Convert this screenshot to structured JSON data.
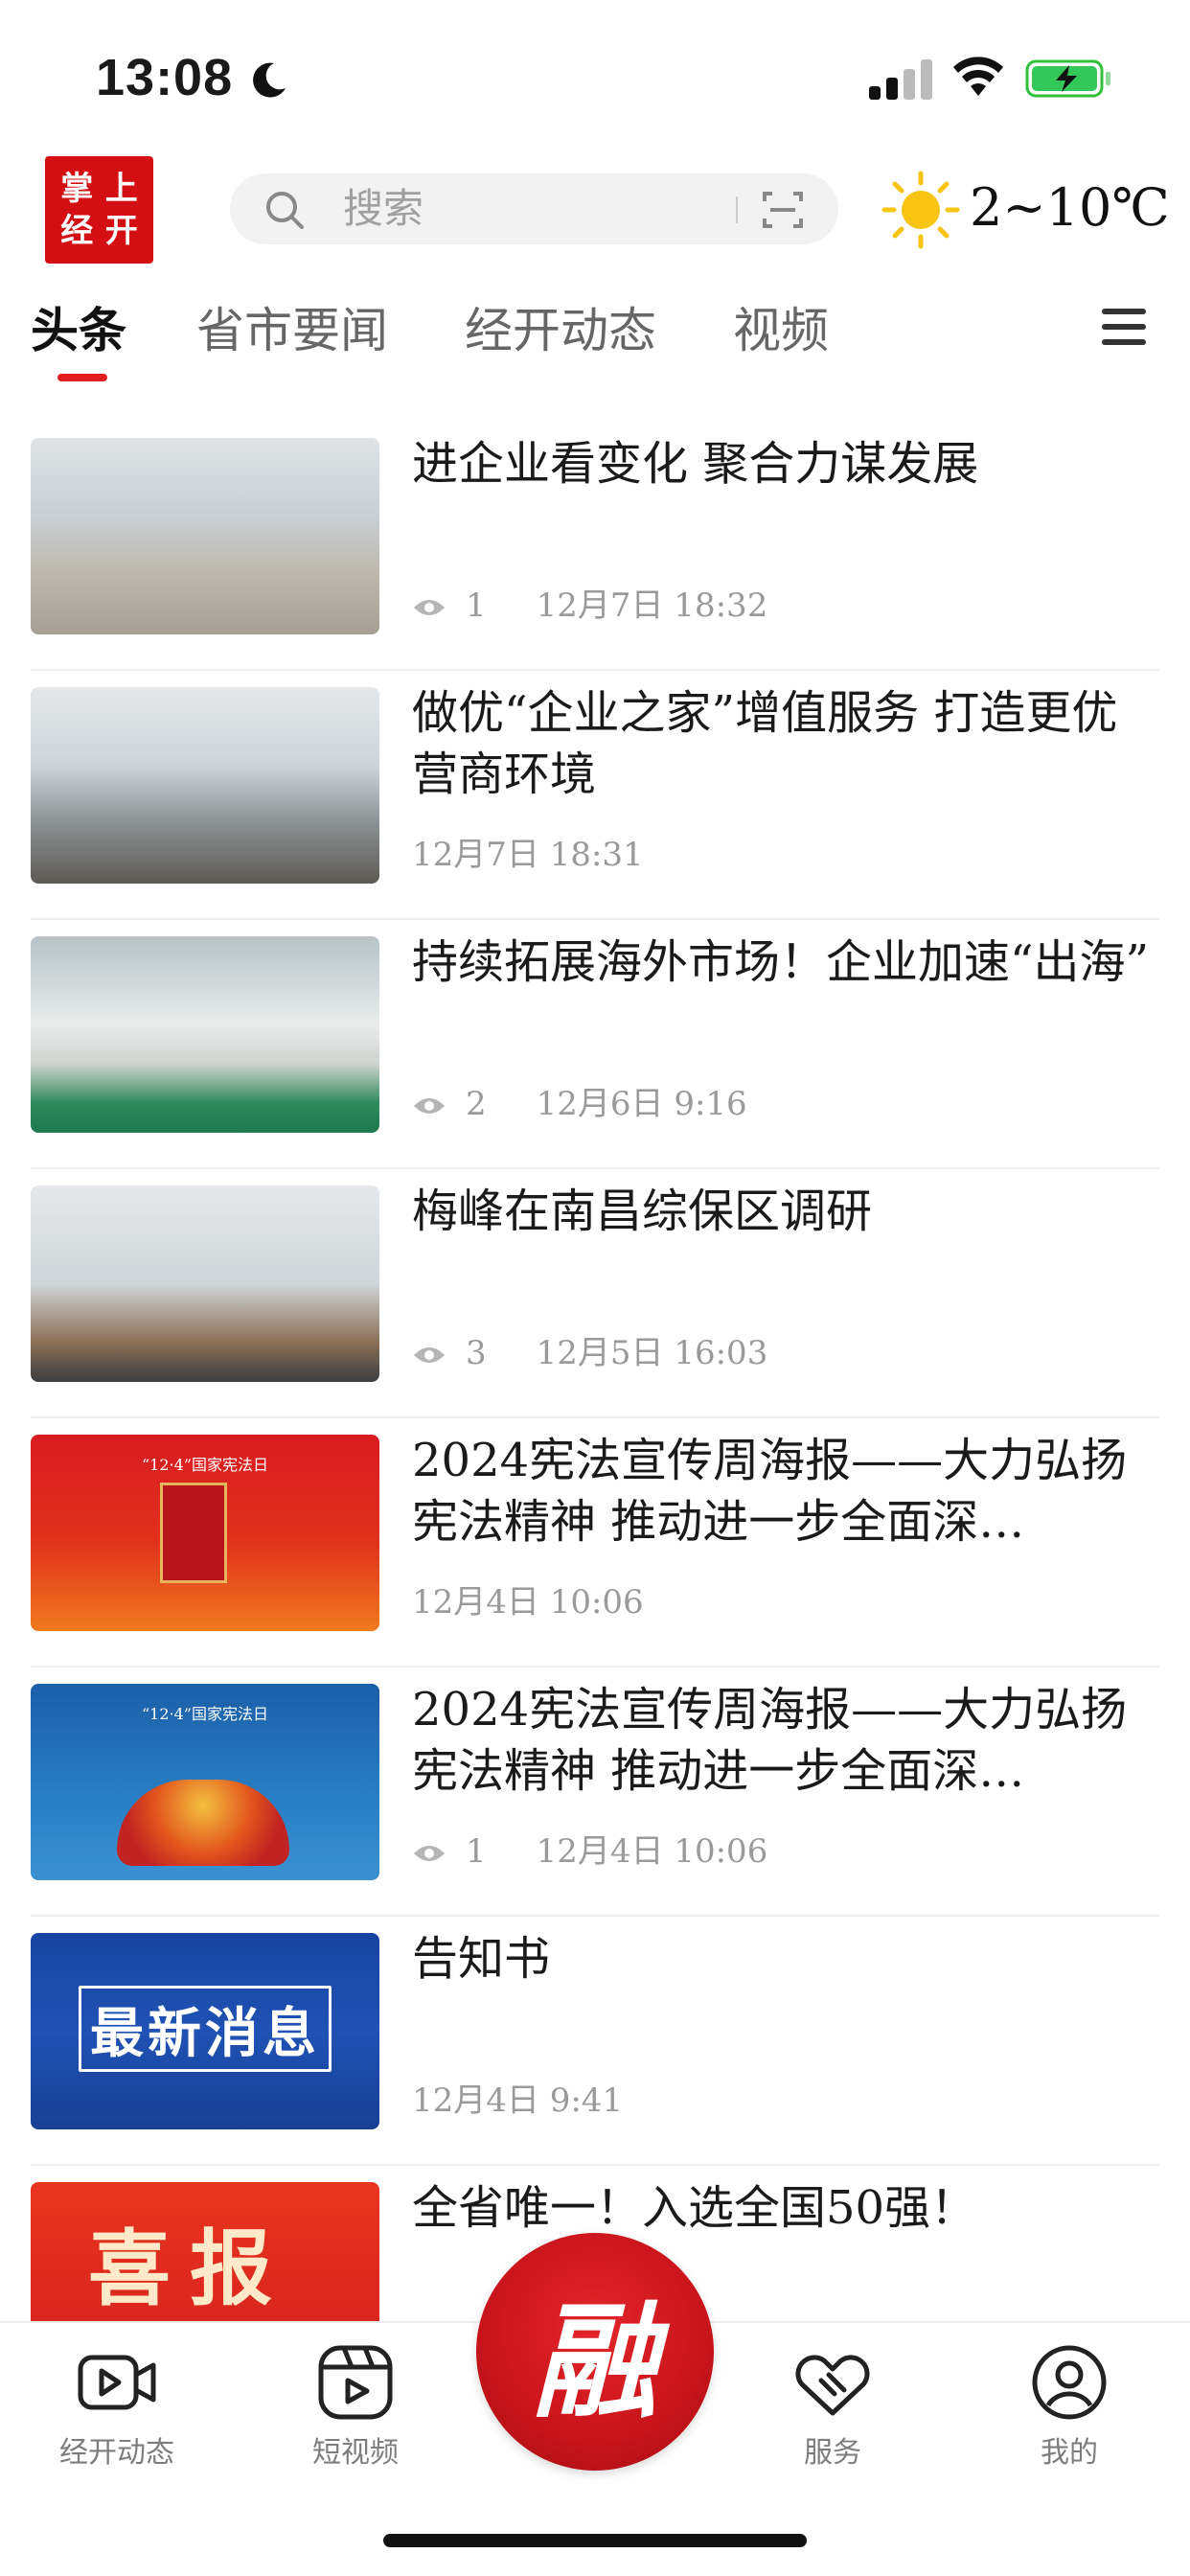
{
  "status_bar": {
    "time": "13:08"
  },
  "header": {
    "logo_chars": [
      "掌",
      "上",
      "经",
      "开"
    ],
    "search_placeholder": "搜索",
    "weather": "2~10℃"
  },
  "tabs": [
    {
      "label": "头条",
      "active": true
    },
    {
      "label": "省市要闻",
      "active": false
    },
    {
      "label": "经开动态",
      "active": false
    },
    {
      "label": "视频",
      "active": false
    }
  ],
  "news": [
    {
      "title": "进企业看变化  聚合力谋发展",
      "views": "1",
      "date": "12月7日  18:32",
      "thumb": "hall"
    },
    {
      "title": "做优“企业之家”增值服务  打造更优营商环境",
      "views": "",
      "date": "12月7日  18:31",
      "thumb": "office"
    },
    {
      "title": "持续拓展海外市场！企业加速“出海”",
      "views": "2",
      "date": "12月6日  9:16",
      "thumb": "factory"
    },
    {
      "title": "梅峰在南昌综保区调研",
      "views": "3",
      "date": "12月5日  16:03",
      "thumb": "visit"
    },
    {
      "title": "2024宪法宣传周海报——大力弘扬宪法精神  推动进一步全面深…",
      "views": "",
      "date": "12月4日  10:06",
      "thumb": "poster-red"
    },
    {
      "title": "2024宪法宣传周海报——大力弘扬宪法精神  推动进一步全面深…",
      "views": "1",
      "date": "12月4日  10:06",
      "thumb": "poster-blue"
    },
    {
      "title": "告知书",
      "views": "",
      "date": "12月4日  9:41",
      "thumb": "latest"
    },
    {
      "title": "全省唯一！入选全国50强！",
      "views": "",
      "date": "",
      "thumb": "xibao"
    }
  ],
  "thumb_text": {
    "latest": "最新消息",
    "xibao": "喜报",
    "poster_caption_red": "“12·4”国家宪法日",
    "poster_caption_blue": "“12·4”国家宪法日"
  },
  "bottom_nav": [
    {
      "label": "经开动态",
      "icon": "video-play-icon"
    },
    {
      "label": "短视频",
      "icon": "short-video-icon"
    },
    {
      "label": "融",
      "icon": "rong-center-button"
    },
    {
      "label": "服务",
      "icon": "handshake-icon"
    },
    {
      "label": "我的",
      "icon": "user-profile-icon"
    }
  ],
  "colors": {
    "accent": "#e21f1f",
    "logo_bg": "#d40f14",
    "meta_text": "#9a9a9a"
  }
}
